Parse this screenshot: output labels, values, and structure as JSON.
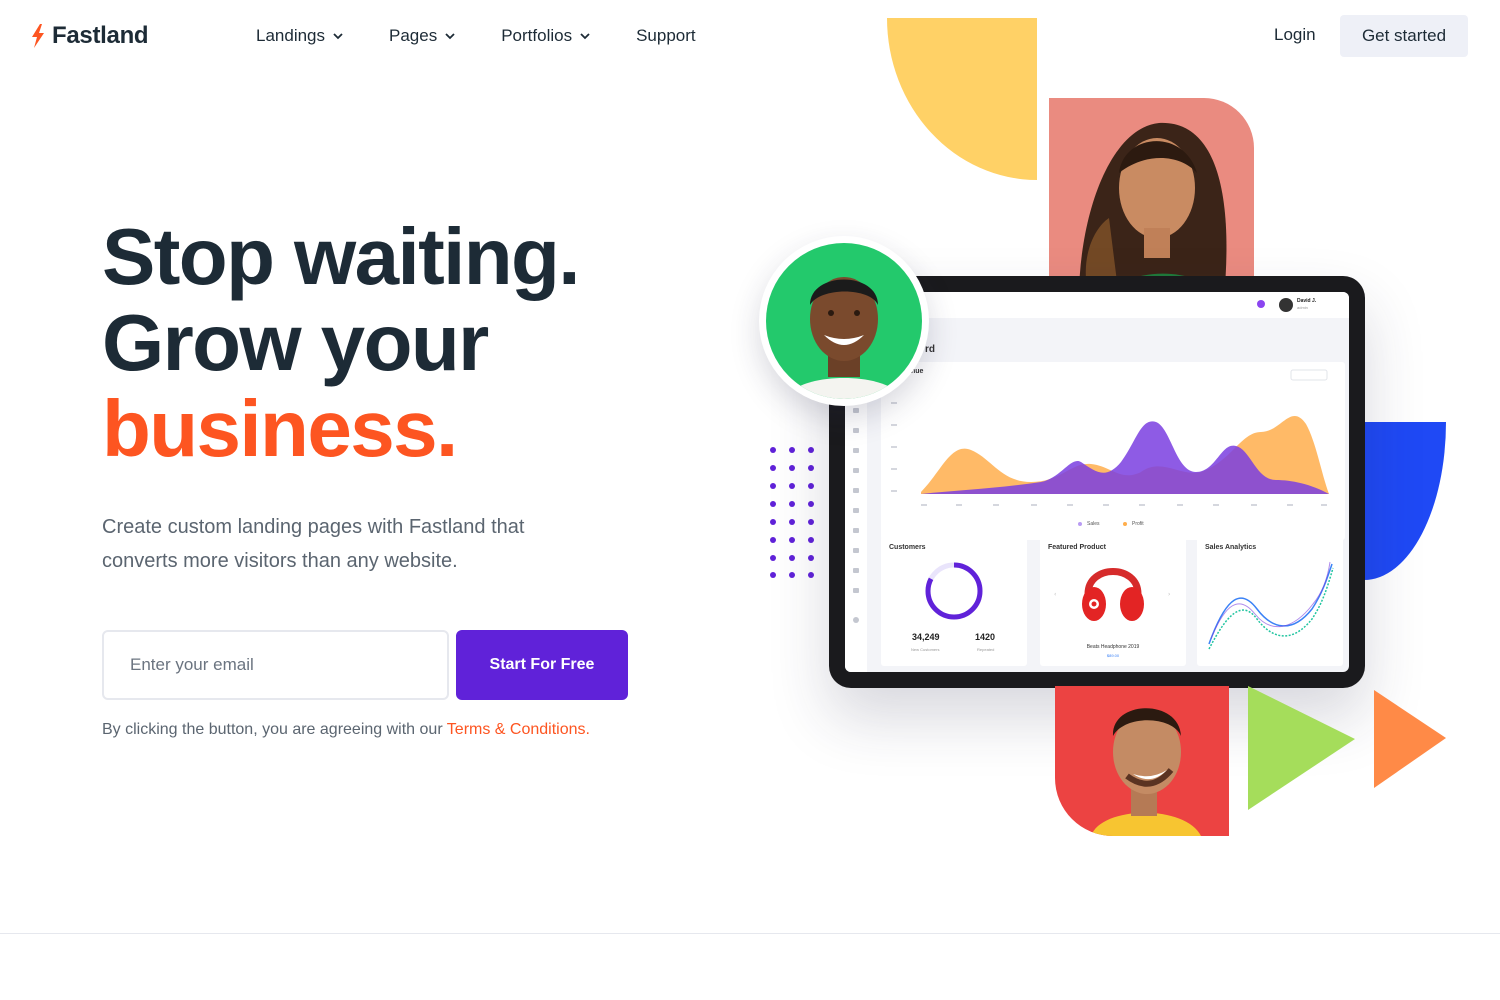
{
  "brand": {
    "name": "Fastland",
    "accent": "#fd5521"
  },
  "nav": {
    "items": [
      {
        "label": "Landings",
        "has_dropdown": true
      },
      {
        "label": "Pages",
        "has_dropdown": true
      },
      {
        "label": "Portfolios",
        "has_dropdown": true
      },
      {
        "label": "Support",
        "has_dropdown": false
      }
    ],
    "login_label": "Login",
    "cta_label": "Get started"
  },
  "hero": {
    "headline_line1": "Stop waiting.",
    "headline_line2": "Grow your",
    "headline_line3": "business.",
    "subtitle": "Create custom landing pages with Fastland that converts more visitors than any website.",
    "email_placeholder": "Enter your email",
    "button_label": "Start For Free",
    "button_color": "#6022d9",
    "legal_text": "By clicking the button, you are agreeing with our",
    "legal_link": "Terms & Conditions."
  },
  "dashboard": {
    "title": "rd",
    "revenue_title": "nue",
    "legend_sales": "Sales",
    "legend_profit": "Profit",
    "user_name": "David J.",
    "user_role": "admin",
    "customers": {
      "title": "Customers",
      "value_new": "34,249",
      "value_repeat": "1420",
      "label_new": "New Customers",
      "label_repeat": "Repeated"
    },
    "product": {
      "title": "Featured Product",
      "name": "Beats Headphone 2019",
      "price": "$89.00"
    },
    "sales": {
      "title": "Sales Analytics"
    }
  },
  "colors": {
    "yellow": "#ffd166",
    "blue": "#1f49f5",
    "green_triangle": "#a5dd5b",
    "orange_triangle": "#ff8a47",
    "purple": "#6022d9",
    "photo_pink": "#ea8b80",
    "photo_red": "#ec4342",
    "avatar_green": "#23c96c"
  },
  "icons": [
    "bolt-icon",
    "chevron-down-icon"
  ]
}
